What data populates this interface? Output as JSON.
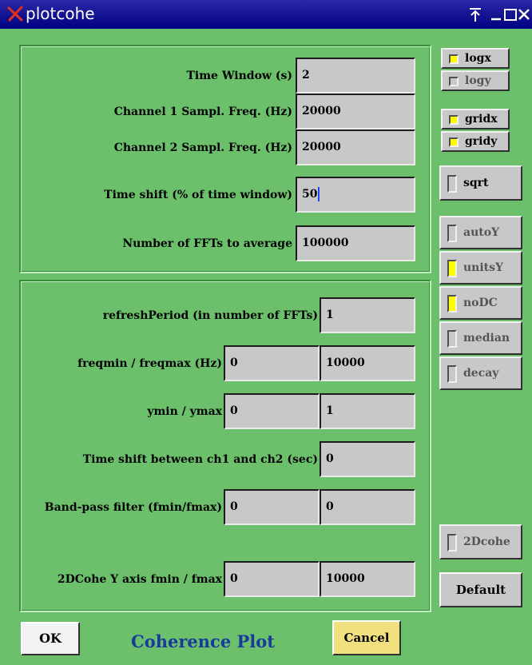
{
  "window": {
    "title": "plotcohe",
    "controls": [
      "pin-icon",
      "minimize-icon",
      "maximize-icon",
      "close-icon"
    ]
  },
  "panel1": {
    "rows": [
      {
        "label": "Time Window (s)",
        "value": "2"
      },
      {
        "label": "Channel 1 Sampl. Freq. (Hz)",
        "value": "20000"
      },
      {
        "label": "Channel 2 Sampl. Freq. (Hz)",
        "value": "20000"
      },
      {
        "label": "Time shift (% of time window)",
        "value": "50"
      },
      {
        "label": "Number of FFTs to average",
        "value": "100000"
      }
    ]
  },
  "panel2": {
    "refresh": {
      "label": "refreshPeriod (in number of FFTs)",
      "value": "1"
    },
    "freq": {
      "label": "freqmin / freqmax (Hz)",
      "min": "0",
      "max": "10000"
    },
    "y": {
      "label": "ymin / ymax",
      "min": "0",
      "max": "1"
    },
    "shift": {
      "label": "Time shift between ch1 and ch2 (sec)",
      "value": "0"
    },
    "bandpass": {
      "label": "Band-pass filter (fmin/fmax)",
      "min": "0",
      "max": "0"
    },
    "cohe2d": {
      "label": "2DCohe Y axis fmin / fmax",
      "min": "0",
      "max": "10000"
    }
  },
  "toggles": {
    "logx": {
      "label": "logx",
      "on": true
    },
    "logy": {
      "label": "logy",
      "on": false
    },
    "gridx": {
      "label": "gridx",
      "on": true
    },
    "gridy": {
      "label": "gridy",
      "on": true
    },
    "sqrt": {
      "label": "sqrt",
      "on": false
    },
    "autoY": {
      "label": "autoY",
      "on": false
    },
    "unitsY": {
      "label": "unitsY",
      "on": true
    },
    "noDC": {
      "label": "noDC",
      "on": true
    },
    "median": {
      "label": "median",
      "on": false
    },
    "decay": {
      "label": "decay",
      "on": false
    },
    "cohe2d": {
      "label": "2Dcohe",
      "on": false
    }
  },
  "buttons": {
    "default": "Default",
    "ok": "OK",
    "cancel": "Cancel"
  },
  "footer": {
    "title": "Coherence Plot"
  },
  "colors": {
    "background": "#6cc06c",
    "titlebar": "#000080",
    "field": "#c8c8c8",
    "indicator_on": "#ffff00",
    "cancel": "#f0e080",
    "footer_title": "#1a3a9a"
  }
}
